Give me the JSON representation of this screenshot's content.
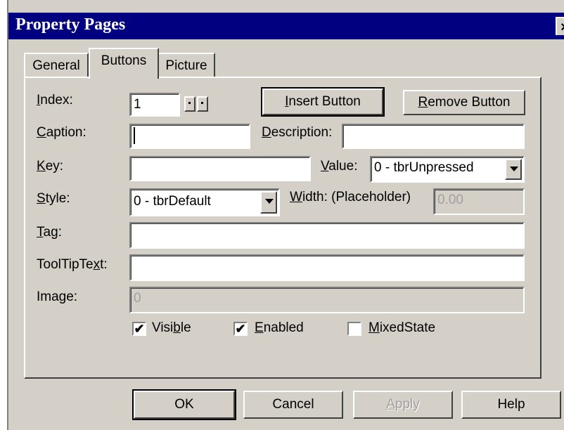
{
  "window": {
    "title": "Property Pages",
    "close_label": "×"
  },
  "tabs": [
    {
      "label": "General"
    },
    {
      "label": "Buttons"
    },
    {
      "label": "Picture"
    }
  ],
  "fields": {
    "index": {
      "label_pre": "",
      "label_u": "I",
      "label_post": "ndex:",
      "value": "1"
    },
    "caption": {
      "label_pre": "",
      "label_u": "C",
      "label_post": "aption:",
      "value": ""
    },
    "description": {
      "label_pre": "",
      "label_u": "D",
      "label_post": "escription:",
      "value": ""
    },
    "key": {
      "label_pre": "",
      "label_u": "K",
      "label_post": "ey:",
      "value": ""
    },
    "value": {
      "label_pre": "",
      "label_u": "V",
      "label_post": "alue:",
      "selected": "0 - tbrUnpressed"
    },
    "style": {
      "label_pre": "",
      "label_u": "S",
      "label_post": "tyle:",
      "selected": "0 - tbrDefault"
    },
    "width": {
      "label_pre": "",
      "label_u": "W",
      "label_post": "idth: (Placeholder)",
      "value": "0.00"
    },
    "tag": {
      "label_pre": "",
      "label_u": "T",
      "label_post": "ag:",
      "value": ""
    },
    "tooltip": {
      "label_pre": "ToolTipTe",
      "label_u": "x",
      "label_post": "t:",
      "value": ""
    },
    "image": {
      "label": "Image:",
      "value": "0"
    }
  },
  "buttons": {
    "insert": {
      "pre": "",
      "u": "I",
      "post": "nsert Button"
    },
    "remove": {
      "pre": "",
      "u": "R",
      "post": "emove Button"
    },
    "ok": "OK",
    "cancel": "Cancel",
    "apply": {
      "pre": "",
      "u": "A",
      "post": "pply"
    },
    "help": "Help"
  },
  "checkboxes": [
    {
      "pre": "Visi",
      "u": "b",
      "post": "le",
      "checked": true,
      "mark": "✔"
    },
    {
      "pre": "",
      "u": "E",
      "post": "nabled",
      "checked": true,
      "mark": "✔"
    },
    {
      "pre": "",
      "u": "M",
      "post": "ixedState",
      "checked": false,
      "mark": ""
    }
  ]
}
